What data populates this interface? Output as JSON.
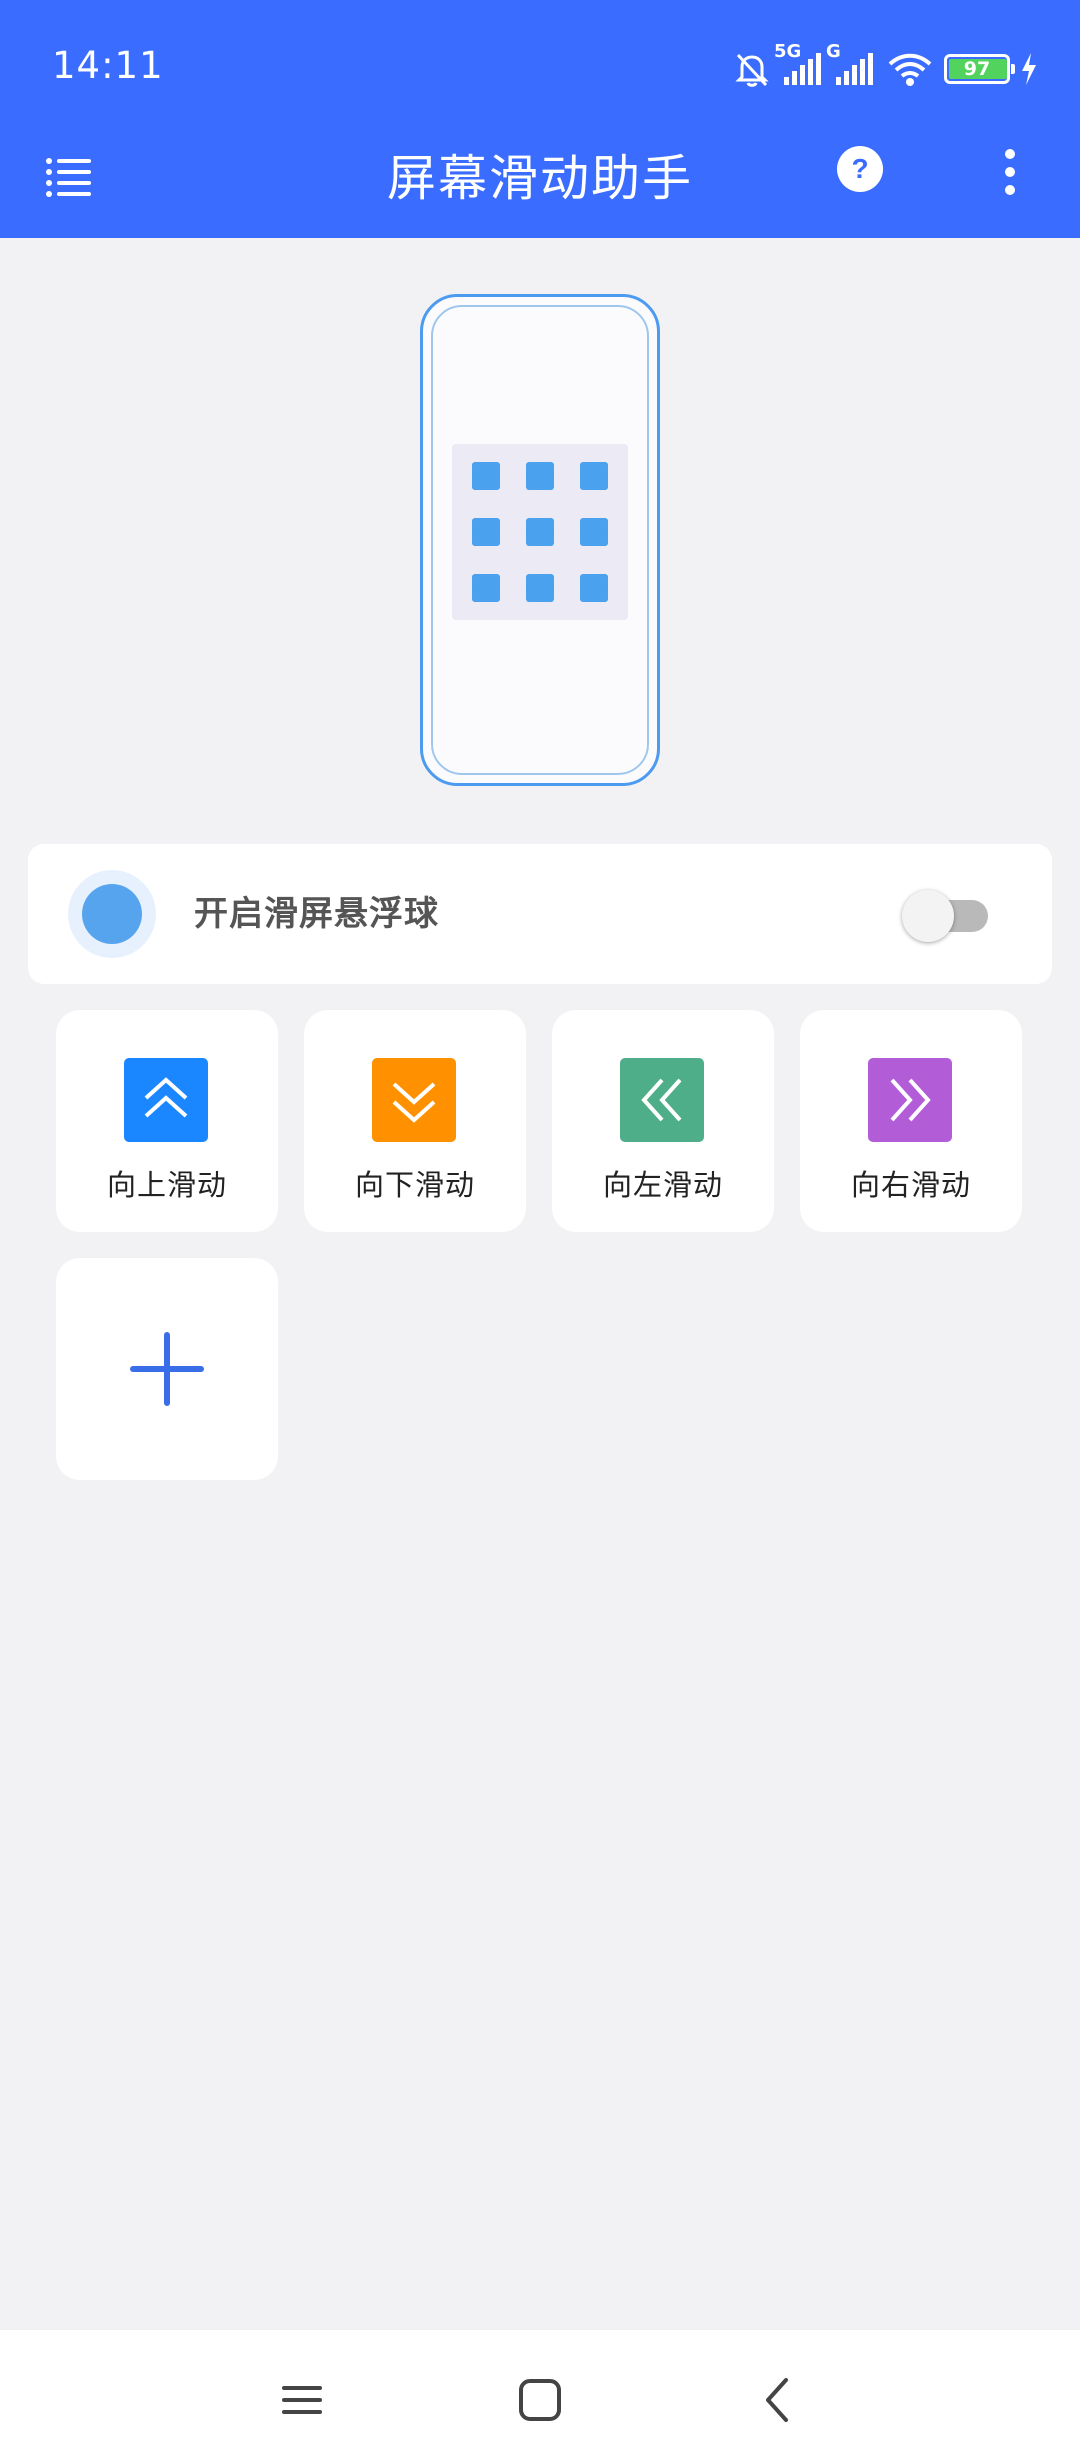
{
  "status_bar": {
    "time": "14:11",
    "signal1_tag": "5G",
    "signal2_tag": "G",
    "battery_level": "97"
  },
  "toolbar": {
    "title": "屏幕滑动助手",
    "menu_icon": "list-menu-icon",
    "help_icon": "help-icon",
    "more_icon": "more-vertical-icon"
  },
  "floating_ball": {
    "label": "开启滑屏悬浮球",
    "enabled": false
  },
  "actions": [
    {
      "label": "向上滑动",
      "icon": "double-chevron-up-icon",
      "color": "#1a86ff"
    },
    {
      "label": "向下滑动",
      "icon": "double-chevron-down-icon",
      "color": "#ff9100"
    },
    {
      "label": "向左滑动",
      "icon": "double-chevron-left-icon",
      "color": "#4fae8a"
    },
    {
      "label": "向右滑动",
      "icon": "double-chevron-right-icon",
      "color": "#b35cd8"
    }
  ],
  "add_action": {
    "icon": "plus-icon"
  },
  "nav": {
    "menu_icon": "recents-icon",
    "home_icon": "home-icon",
    "back_icon": "back-icon"
  },
  "colors": {
    "header": "#3a6cff",
    "background": "#f2f2f5",
    "accent_blue": "#4d9bf0"
  }
}
